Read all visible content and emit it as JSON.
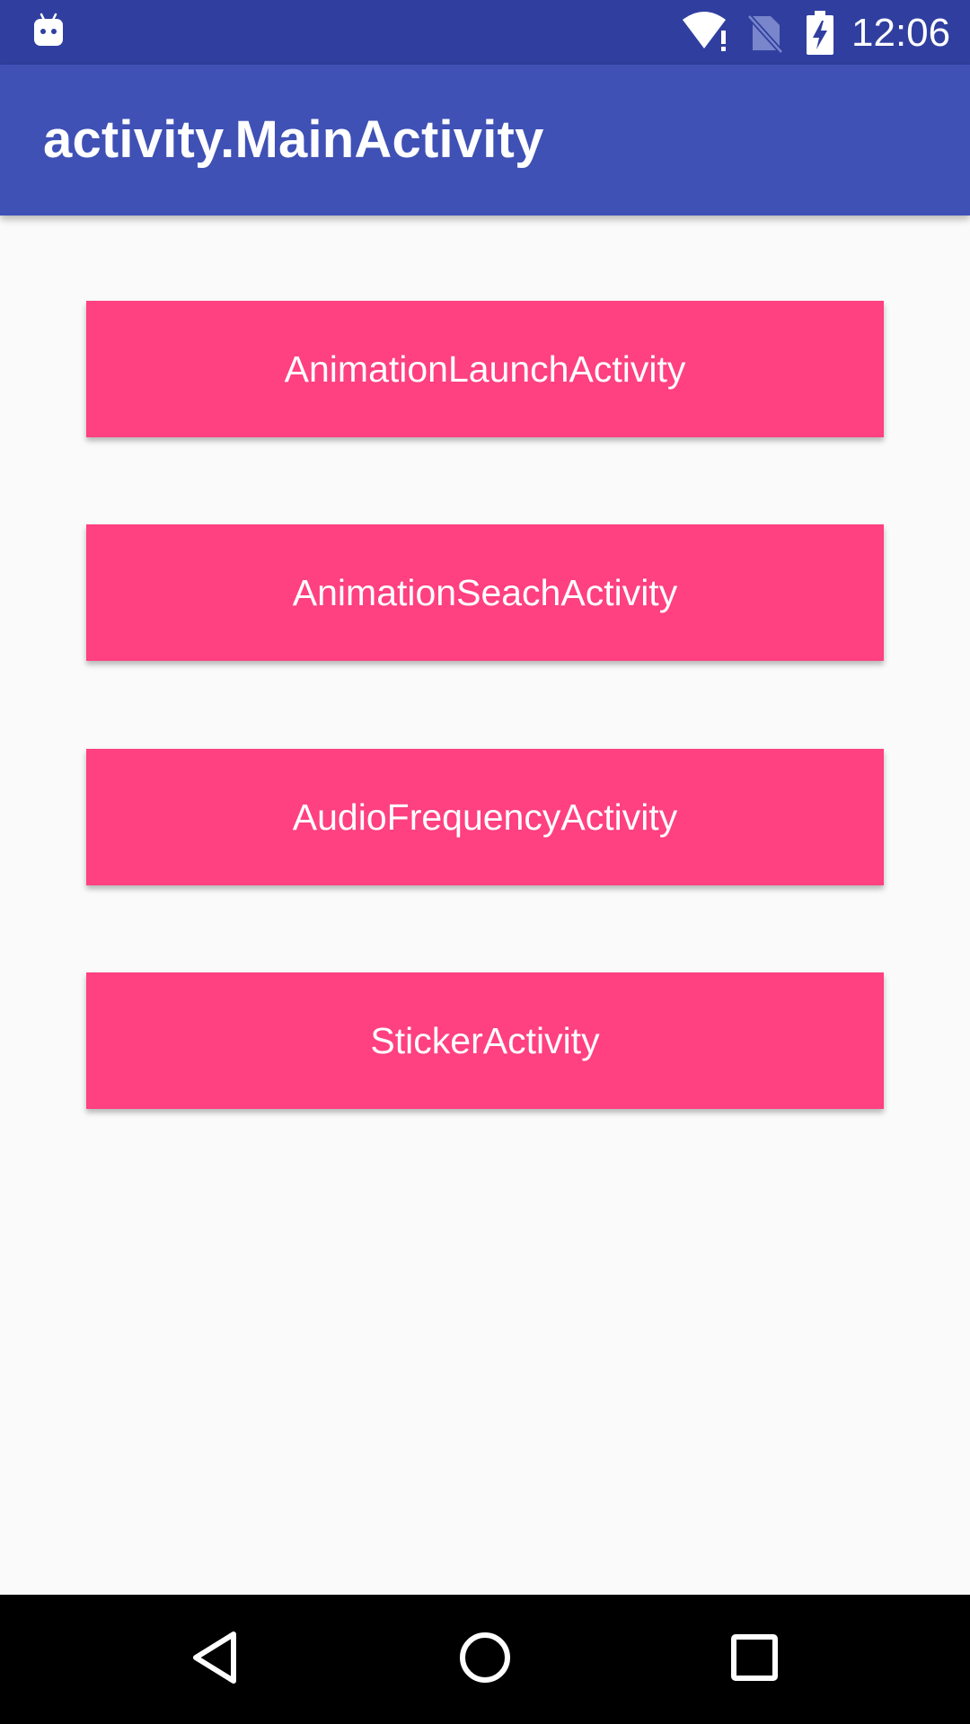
{
  "status_bar": {
    "time": "12:06",
    "icons": [
      "android-debug-icon",
      "wifi-alert-icon",
      "no-sim-icon",
      "battery-charging-icon"
    ],
    "background": "#303f9f"
  },
  "app_bar": {
    "title": "activity.MainActivity",
    "background": "#3f51b5"
  },
  "buttons": [
    {
      "label": "AnimationLaunchActivity"
    },
    {
      "label": "AnimationSeachActivity"
    },
    {
      "label": "AudioFrequencyActivity"
    },
    {
      "label": "StickerActivity"
    }
  ],
  "button_color": "#ff4081",
  "nav_bar": {
    "icons": [
      "back-icon",
      "home-icon",
      "recents-icon"
    ]
  }
}
